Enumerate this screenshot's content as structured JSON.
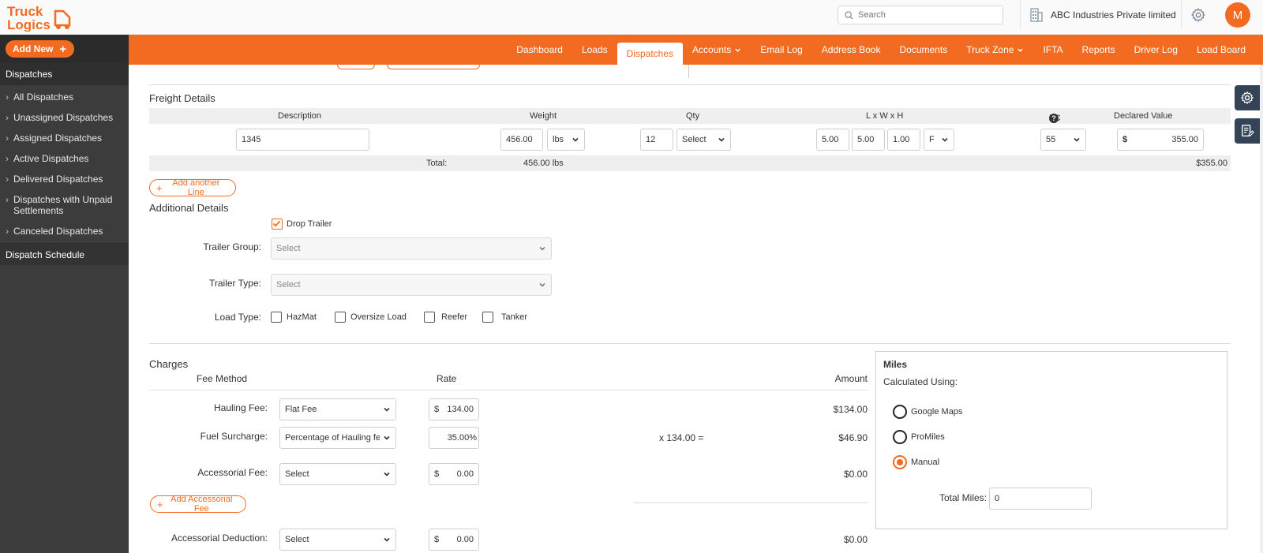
{
  "app": {
    "logo_line1": "Truck",
    "logo_line2": "Logics",
    "search_placeholder": "Search",
    "company_name": "ABC Industries Private limited",
    "avatar_initial": "M",
    "brand_color": "#f26b21"
  },
  "sidebar": {
    "add_new_label": "Add New",
    "section_label": "Dispatches",
    "items": [
      {
        "label": "All Dispatches"
      },
      {
        "label": "Unassigned Dispatches"
      },
      {
        "label": "Assigned Dispatches"
      },
      {
        "label": "Active Dispatches"
      },
      {
        "label": "Delivered Dispatches"
      },
      {
        "label": "Dispatches with Unpaid Settlements"
      },
      {
        "label": "Canceled Dispatches"
      }
    ],
    "schedule_label": "Dispatch Schedule"
  },
  "nav": {
    "items": [
      {
        "label": "Dashboard",
        "dropdown": false
      },
      {
        "label": "Loads",
        "dropdown": false
      },
      {
        "label": "Dispatches",
        "dropdown": false,
        "active": true
      },
      {
        "label": "Accounts",
        "dropdown": true
      },
      {
        "label": "Email Log",
        "dropdown": false
      },
      {
        "label": "Address Book",
        "dropdown": false
      },
      {
        "label": "Documents",
        "dropdown": false
      },
      {
        "label": "Truck Zone",
        "dropdown": true
      },
      {
        "label": "IFTA",
        "dropdown": false
      },
      {
        "label": "Reports",
        "dropdown": false
      },
      {
        "label": "Driver Log",
        "dropdown": false
      },
      {
        "label": "Load Board",
        "dropdown": false
      }
    ]
  },
  "freight": {
    "title": "Freight Details",
    "headers": {
      "description": "Description",
      "weight": "Weight",
      "qty": "Qty",
      "dims": "L x W x H",
      "fc": "FC",
      "declared": "Declared Value"
    },
    "row": {
      "description": "1345",
      "weight": "456.00",
      "weight_unit": "lbs",
      "qty": "12",
      "qty_unit": "Select",
      "length": "5.00",
      "width": "5.00",
      "height": "1.00",
      "dim_unit": "F",
      "fc": "55",
      "declared_currency": "$",
      "declared_value": "355.00"
    },
    "total_label": "Total:",
    "total_weight": "456.00 lbs",
    "total_value": "$355.00",
    "add_line_label": "Add another Line"
  },
  "additional": {
    "title": "Additional Details",
    "drop_trailer_label": "Drop Trailer",
    "drop_trailer_checked": true,
    "trailer_group_label": "Trailer Group:",
    "trailer_group_value": "Select",
    "trailer_type_label": "Trailer Type:",
    "trailer_type_value": "Select",
    "load_type_label": "Load Type:",
    "load_types": [
      {
        "label": "HazMat",
        "checked": false
      },
      {
        "label": "Oversize Load",
        "checked": false
      },
      {
        "label": "Reefer",
        "checked": false
      },
      {
        "label": "Tanker",
        "checked": false
      }
    ]
  },
  "charges": {
    "title": "Charges",
    "col_fee_method": "Fee Method",
    "col_rate": "Rate",
    "col_amount": "Amount",
    "hauling_label": "Hauling Fee:",
    "hauling_method": "Flat Fee",
    "hauling_currency": "$",
    "hauling_rate": "134.00",
    "hauling_amount": "$134.00",
    "fuel_label": "Fuel Surcharge:",
    "fuel_method": "Percentage of Hauling fee",
    "fuel_rate": "35.00",
    "fuel_unit": "%",
    "fuel_calc": "x 134.00 =",
    "fuel_amount": "$46.90",
    "accessorial_label": "Accessorial Fee:",
    "accessorial_method": "Select",
    "accessorial_currency": "$",
    "accessorial_rate": "0.00",
    "accessorial_amount": "$0.00",
    "add_accessorial_label": "Add Accessorial Fee",
    "deduction_label": "Accessorial Deduction:",
    "deduction_method": "Select",
    "deduction_currency": "$",
    "deduction_rate": "0.00",
    "deduction_amount": "$0.00"
  },
  "miles": {
    "title": "Miles",
    "calculated_using": "Calculated Using:",
    "options": [
      {
        "label": "Google Maps",
        "selected": false
      },
      {
        "label": "ProMiles",
        "selected": false
      },
      {
        "label": "Manual",
        "selected": true
      }
    ],
    "total_label": "Total Miles:",
    "total_value": "0"
  }
}
